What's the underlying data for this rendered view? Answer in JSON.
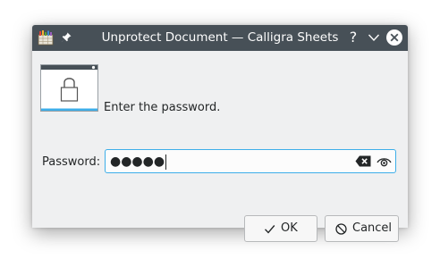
{
  "window": {
    "title": "Unprotect Document — Calligra Sheets",
    "help_label": "?",
    "titlebar_color": "#475057"
  },
  "dialog": {
    "prompt": "Enter the password.",
    "password_label": "Password:",
    "password_mask": "●●●●●",
    "accent_color": "#3daee9"
  },
  "buttons": {
    "ok_label": "OK",
    "cancel_label": "Cancel"
  },
  "icons": {
    "app": "calligra-sheets-icon",
    "pin": "pin-icon",
    "minimize": "chevron-down-icon",
    "close": "close-icon",
    "lock": "lock-dialog-icon",
    "clear": "clear-text-icon",
    "reveal": "eye-icon",
    "ok": "checkmark-icon",
    "cancel": "cancel-icon"
  }
}
